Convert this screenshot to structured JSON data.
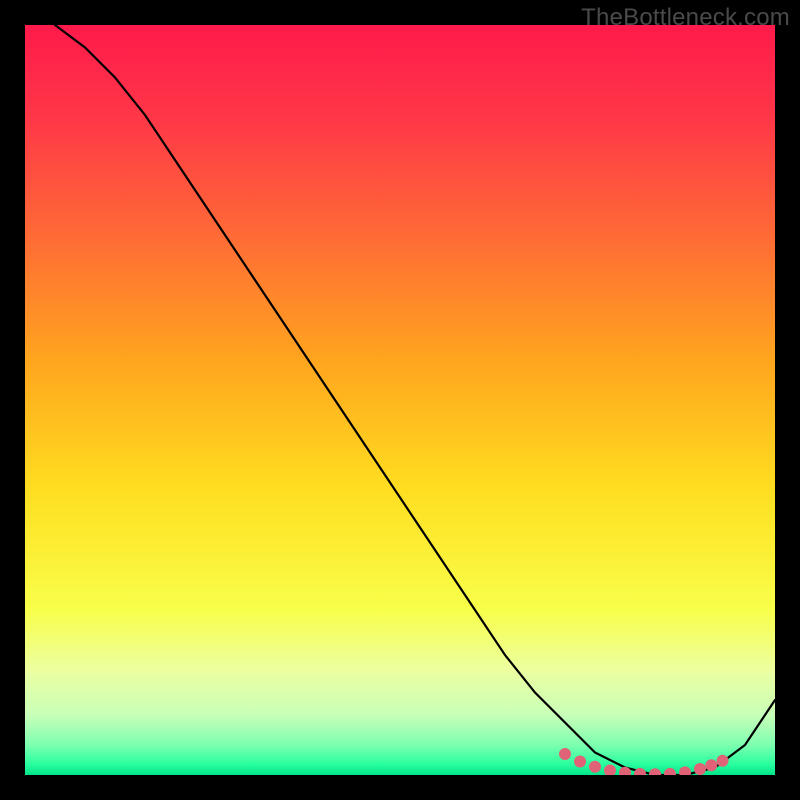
{
  "watermark": "TheBottleneck.com",
  "chart_data": {
    "type": "line",
    "title": "",
    "xlabel": "",
    "ylabel": "",
    "xlim": [
      0,
      100
    ],
    "ylim": [
      0,
      100
    ],
    "grid": false,
    "series": [
      {
        "name": "curve",
        "x": [
          4,
          8,
          12,
          16,
          20,
          24,
          28,
          32,
          36,
          40,
          44,
          48,
          52,
          56,
          60,
          64,
          68,
          72,
          76,
          80,
          84,
          88,
          92,
          96,
          100
        ],
        "y": [
          100,
          97,
          93,
          88,
          82,
          76,
          70,
          64,
          58,
          52,
          46,
          40,
          34,
          28,
          22,
          16,
          11,
          7,
          3,
          1,
          0,
          0,
          1,
          4,
          10
        ]
      }
    ],
    "highlight": {
      "x": [
        72,
        74,
        76,
        78,
        80,
        82,
        84,
        86,
        88,
        90,
        91.5,
        93
      ],
      "y": [
        2.8,
        1.8,
        1.1,
        0.6,
        0.3,
        0.15,
        0.1,
        0.15,
        0.35,
        0.8,
        1.3,
        1.9
      ]
    },
    "gradient_stops": [
      {
        "offset": 0.0,
        "color": "#ff1a4b"
      },
      {
        "offset": 0.12,
        "color": "#ff3648"
      },
      {
        "offset": 0.28,
        "color": "#ff6a36"
      },
      {
        "offset": 0.45,
        "color": "#ffa61e"
      },
      {
        "offset": 0.62,
        "color": "#ffde20"
      },
      {
        "offset": 0.78,
        "color": "#f8ff4a"
      },
      {
        "offset": 0.86,
        "color": "#ecffa0"
      },
      {
        "offset": 0.92,
        "color": "#c8ffb8"
      },
      {
        "offset": 0.96,
        "color": "#7dffb0"
      },
      {
        "offset": 0.985,
        "color": "#2bff9f"
      },
      {
        "offset": 1.0,
        "color": "#00e58a"
      }
    ]
  }
}
